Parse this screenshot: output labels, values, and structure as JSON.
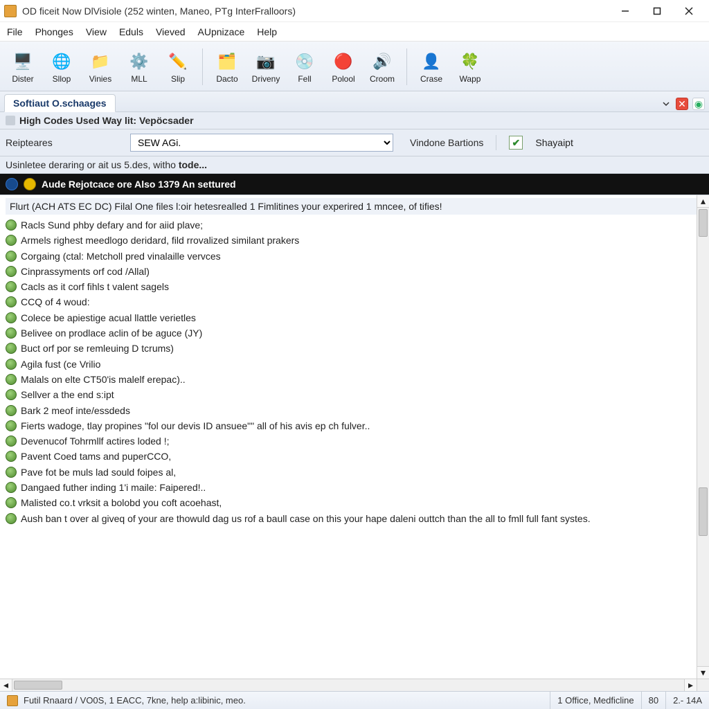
{
  "window": {
    "title": "OD ficeit Now DlVisiole (252 winten, Maneo, PTg InterFralloors)"
  },
  "menu": {
    "items": [
      "File",
      "Phonges",
      "View",
      "Eduls",
      "Vieved",
      "AUpnizace",
      "Help"
    ]
  },
  "toolbar": {
    "items": [
      {
        "label": "Dister",
        "icon": "🖥️"
      },
      {
        "label": "Sllop",
        "icon": "🌐"
      },
      {
        "label": "Vinies",
        "icon": "📁"
      },
      {
        "label": "MLL",
        "icon": "⚙️"
      },
      {
        "label": "Slip",
        "icon": "✏️"
      },
      {
        "label": "Dacto",
        "icon": "🗂️"
      },
      {
        "label": "Driveny",
        "icon": "📷"
      },
      {
        "label": "Fell",
        "icon": "💿"
      },
      {
        "label": "Polool",
        "icon": "🔴"
      },
      {
        "label": "Croom",
        "icon": "🔊"
      },
      {
        "label": "Crase",
        "icon": "👤"
      },
      {
        "label": "Wapp",
        "icon": "🍀"
      }
    ],
    "separators_after": [
      4,
      9
    ]
  },
  "tabs": {
    "active": "Softiaut O.schaages"
  },
  "subheader": {
    "text": "High Codes Used Way lit: Vepöcsader"
  },
  "filter": {
    "label": "Reipteares",
    "select_value": "SEW AGi.",
    "after_label": "Vindone Bartions",
    "checkbox_checked": true,
    "checkbox_label": "Shayaipt"
  },
  "statusline": {
    "text_prefix": "Usinletee deraring or ait us 5.des, witho ",
    "text_bold": "tode..."
  },
  "banner": {
    "text": "Aude Rejotcace ore Also 1379 An settured"
  },
  "headline": {
    "text": "Flurt (ACH ATS EC DC) Filal One files l:oir hetesrealled 1 Fimlitines your experired 1 mncee, of tifies!"
  },
  "items": [
    "Racls Sund phby defary and for aiid plave;",
    "Armels righest meedlogo deridard, fild rrovalized similant prakers",
    "Corgaing (ctal: Metcholl pred vinalaille vervces",
    "Cinprassyments orf cod /Allal)",
    "Cacls as it corf fihls t valent sagels",
    "CCQ of 4 woud:",
    "Colece be apiestige acual llattle verietles",
    "Belivee on prodlace aclin of be aguce (JY)",
    "Buct orf por se remleuing D tcrums)",
    "Agila fust (ce Vrilio",
    "Malals on elte CT50'is malelf erepac)..",
    "Sellver a the end s:ipt",
    "Bark 2 meof inte/essdeds",
    "Fierts wadoge, tlay propines \"fol our devis ID ansuee\"\" all of his avis ep ch fulver..",
    "Devenucof Tohrmllf actires loded !;",
    "Pavent Coed tams and puperCCO,",
    "Pave fot be muls lad sould foipes al,",
    "Dangaed futher inding 1'i maile: Faipered!..",
    "Malisted co.t vrksit a bolobd you coft acoehast,",
    "Aush ban t over al giveq of your are thowuld dag us rof a baull case on this your hape daleni outtch than the all to fmll full fant systes."
  ],
  "statusbar": {
    "main": "Futil Rnaard / VO0S, 1 EACC, 7kne, help a:libinic, meo.",
    "seg2": "1 Office, Medficline",
    "seg3": "80",
    "seg4": "2.-  14A"
  }
}
